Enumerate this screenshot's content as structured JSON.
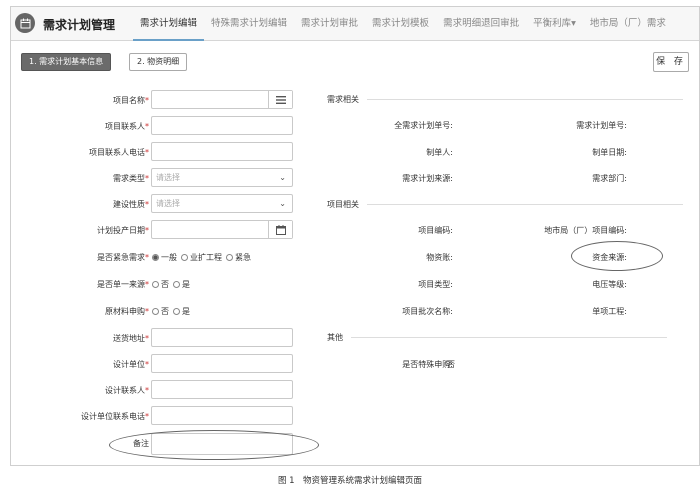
{
  "app": {
    "title": "需求计划管理"
  },
  "tabs": [
    "需求计划编辑",
    "特殊需求计划编辑",
    "需求计划审批",
    "需求计划模板",
    "需求明细退回审批",
    "平衡利库▾",
    "地市局（厂）需求"
  ],
  "toolbar": {
    "step1": "1. 需求计划基本信息",
    "step2": "2. 物资明细",
    "save": "保 存"
  },
  "form": {
    "required_mark": "*",
    "project_name": "项目名称",
    "project_contact": "项目联系人",
    "project_contact_phone": "项目联系人电话",
    "demand_type": "需求类型",
    "construction_nature": "建设性质",
    "select_placeholder": "请选择",
    "plan_date": "计划投产日期",
    "is_urgent": "是否紧急需求",
    "urgent_options": [
      "一般",
      "业扩工程",
      "紧急"
    ],
    "single_source": "是否单一来源",
    "raw_material": "原材料申购",
    "yes": "是",
    "no": "否",
    "delivery_address": "送货地址",
    "design_unit": "设计单位",
    "design_contact": "设计联系人",
    "design_contact_phone": "设计单位联系电话",
    "remark": "备注"
  },
  "sections": {
    "demand": "需求相关",
    "project": "项目相关",
    "other": "其他"
  },
  "right": {
    "full_plan_no": "全需求计划单号:",
    "plan_no": "需求计划单号:",
    "creator": "制单人:",
    "create_date": "制单日期:",
    "plan_source": "需求计划来源:",
    "demand_dept": "需求部门:",
    "project_code": "项目编码:",
    "city_project_code": "地市局（厂）项目编码:",
    "material_account": "物资账:",
    "fund_source": "资金来源:",
    "project_type": "项目类型:",
    "voltage_level": "电压等级:",
    "approval_name": "项目批次名称:",
    "single_project": "单项工程:",
    "special_purchase": "是否特殊申购:",
    "special_purchase_value": "否"
  },
  "caption": "图 1　物资管理系统需求计划编辑页面"
}
